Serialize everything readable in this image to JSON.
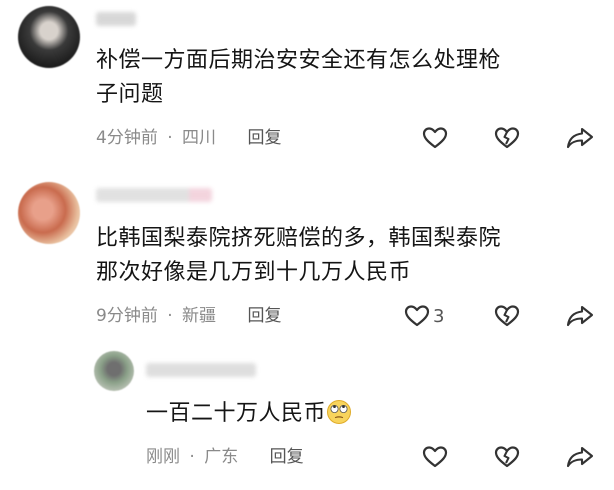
{
  "comments": [
    {
      "text_line1": "补偿一方面后期治安安全还有怎么处理枪",
      "text_line2": "子问题",
      "time": "4分钟前",
      "location": "四川",
      "reply_label": "回复",
      "like_count": ""
    },
    {
      "text_line1": "比韩国梨泰院挤死赔偿的多，韩国梨泰院",
      "text_line2": "那次好像是几万到十几万人民币",
      "time": "9分钟前",
      "location": "新疆",
      "reply_label": "回复",
      "like_count": "3"
    },
    {
      "text_line1": "一百二十万人民币",
      "emoji": "eye-roll-emoji",
      "time": "刚刚",
      "location": "广东",
      "reply_label": "回复",
      "like_count": ""
    }
  ],
  "separator": "·",
  "colors": {
    "text": "#151515",
    "meta": "#8a8a8a",
    "icon": "#333333",
    "background": "#ffffff"
  }
}
